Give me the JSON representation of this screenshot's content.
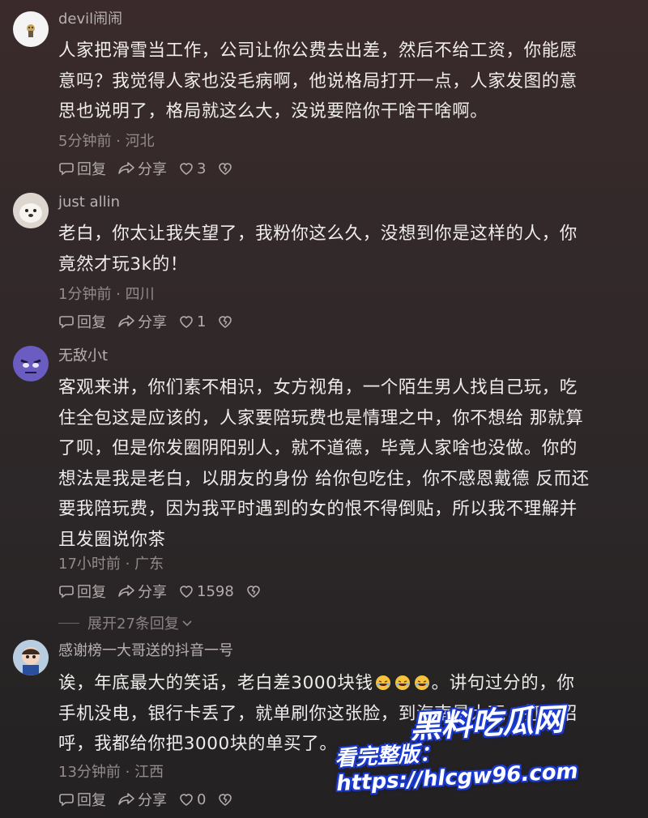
{
  "comments": [
    {
      "username": "devil闹闹",
      "lines": [
        "人家把滑雪当工作，公司让你公费去出差，然后不给工资，你能愿",
        "意吗？我觉得人家也没毛病啊，他说格局打开一点，人家发图的意",
        "思也说明了，格局就这么大，没说要陪你干啥干啥啊。"
      ],
      "meta": "5分钟前 · 河北",
      "reply": "回复",
      "share": "分享",
      "likes": "3"
    },
    {
      "username": "just allin",
      "lines": [
        "老白，你太让我失望了，我粉你这么久，没想到你是这样的人，你",
        "竟然才玩3k的！"
      ],
      "meta": "1分钟前 · 四川",
      "reply": "回复",
      "share": "分享",
      "likes": "1"
    },
    {
      "username": "无敌小t",
      "lines": [
        "客观来讲，你们素不相识，女方视角，一个陌生男人找自己玩，吃",
        "住全包这是应该的，人家要陪玩费也是情理之中，你不想给 那就算",
        "了呗，但是你发圈阴阳别人，就不道德，毕竟人家啥也没做。你的",
        "想法是我是老白，以朋友的身份 给你包吃住，你不感恩戴德 反而还",
        "要我陪玩费，因为我平时遇到的女的恨不得倒贴，所以我不理解并",
        "且发圈说你茶"
      ],
      "meta": "17小时前 · 广东",
      "reply": "回复",
      "share": "分享",
      "likes": "1598",
      "expand": "展开27条回复"
    },
    {
      "username": "感谢榜一大哥送的抖音一号",
      "line1_a": "诶，年底最大的笑话，老白差3000块钱",
      "line1_b": "。讲句过分的，你",
      "lines": [
        "手机没电，银行卡丢了，就单刷你这张脸，到海南是大玩，打个招",
        "呼，我都给你把3000块的单买了。"
      ],
      "meta": "13分钟前 · 江西",
      "reply": "回复",
      "share": "分享",
      "likes": "0"
    }
  ],
  "watermark": {
    "brand": "黑料吃瓜网",
    "url": "看完整版：https://hlcgw96.com"
  }
}
